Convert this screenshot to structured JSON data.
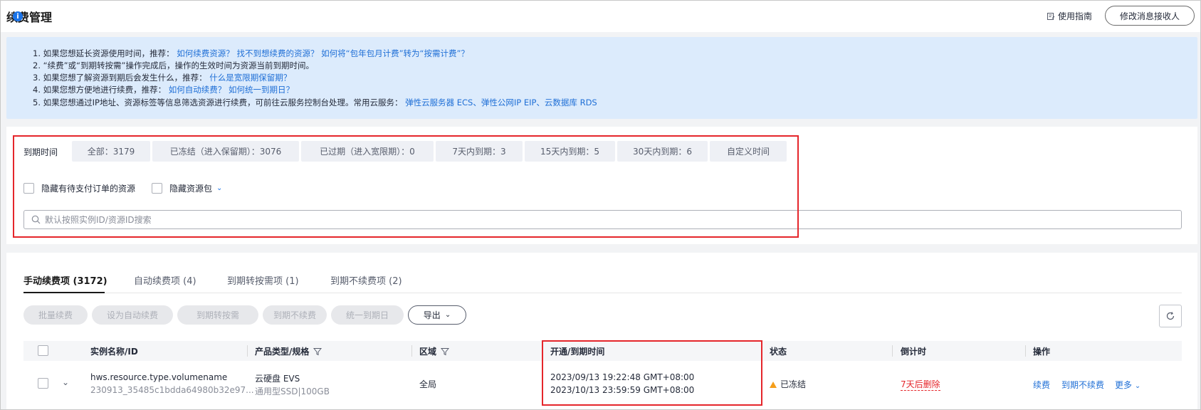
{
  "header": {
    "title": "续费管理",
    "guide_label": "使用指南",
    "modify_receiver_label": "修改消息接收人"
  },
  "notice": {
    "lines": [
      {
        "text": "1. 如果您想延长资源使用时间，推荐：",
        "links": "如何续费资源？ 找不到想续费的资源？ 如何将“包年包月计费”转为“按需计费”？"
      },
      {
        "text": "2. “续费”或“到期转按需”操作完成后，操作的生效时间为资源当前到期时间。",
        "links": ""
      },
      {
        "text": "3. 如果您想了解资源到期后会发生什么，推荐：",
        "links": "什么是宽限期保留期？"
      },
      {
        "text": "4. 如果您想方便地进行续费，推荐：",
        "links": "如何自动续费？ 如何统一到期日？"
      },
      {
        "text": "5. 如果您想通过IP地址、资源标签等信息筛选资源进行续费，可前往云服务控制台处理。常用云服务：",
        "links": "弹性云服务器 ECS、弹性公网IP EIP、云数据库 RDS"
      }
    ]
  },
  "filter": {
    "label": "到期时间",
    "chips": [
      "全部：3179",
      "已冻结（进入保留期）：3076",
      "已过期（进入宽限期）：0",
      "7天内到期：3",
      "15天内到期：5",
      "30天内到期：6",
      "自定义时间"
    ],
    "hide_pending_label": "隐藏有待支付订单的资源",
    "hide_package_label": "隐藏资源包",
    "search_placeholder": "默认按照实例ID/资源ID搜索"
  },
  "tabs": [
    "手动续费项 (3172)",
    "自动续费项 (4)",
    "到期转按需项 (1)",
    "到期不续费项 (2)"
  ],
  "toolbar": {
    "batch_renew": "批量续费",
    "set_auto_renew": "设为自动续费",
    "to_on_demand": "到期转按需",
    "no_renew": "到期不续费",
    "unify_expiry": "统一到期日",
    "export": "导出"
  },
  "table": {
    "columns": [
      "实例名称/ID",
      "产品类型/规格",
      "区域",
      "开通/到期时间",
      "状态",
      "倒计时",
      "操作"
    ],
    "rows": [
      {
        "name": "hws.resource.type.volumename",
        "id": "230913_35485c1bdda64980b32e97...",
        "product": "云硬盘 EVS",
        "spec": "通用型SSD|100GB",
        "region": "全局",
        "start_time": "2023/09/13 19:22:48 GMT+08:00",
        "end_time": "2023/10/13 23:59:59 GMT+08:00",
        "status": "已冻结",
        "countdown": "7天后删除",
        "actions": {
          "renew": "续费",
          "no_renew": "到期不续费",
          "more": "更多"
        }
      }
    ]
  },
  "colors": {
    "accent": "#1f6fd6",
    "danger": "#e5262b",
    "warning": "#f59e1a",
    "notice_bg": "#dcebfc"
  }
}
